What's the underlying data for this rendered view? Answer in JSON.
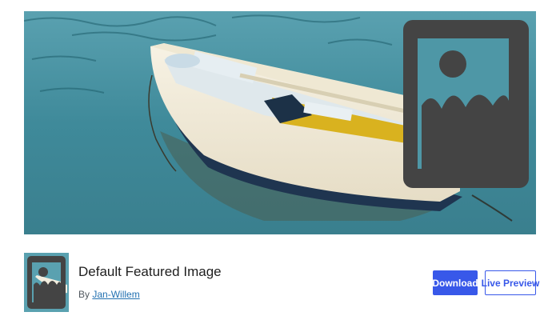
{
  "plugin": {
    "title": "Default Featured Image",
    "author_prefix": "By",
    "author_name": "Jan-Willem"
  },
  "actions": {
    "download_label": "Download",
    "preview_label": "Live Preview"
  },
  "colors": {
    "accent": "#3858e9",
    "water": "#3f8a9a",
    "placeholder_icon": "#4a4a4a"
  },
  "icons": {
    "banner_overlay": "image-placeholder-icon",
    "plugin_icon": "image-placeholder-icon"
  }
}
